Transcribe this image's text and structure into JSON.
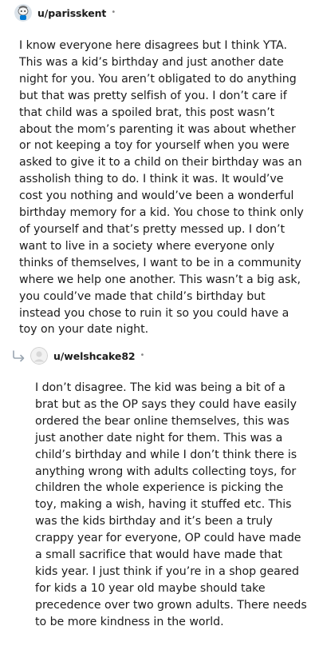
{
  "comments": [
    {
      "username": "u/parisskent",
      "separator": "•",
      "avatar_icon": "snoo-avatar-icon",
      "body": "I know everyone here disagrees but I think YTA. This was a kid’s birthday and just another date night for you. You aren’t obligated to do anything but that was pretty selfish of you. I don’t care if that child was a spoiled brat, this post wasn’t about the mom’s parenting it was about whether or not keeping a toy for yourself when you were asked to give it to a child on their birthday was an assholish thing to do. I think it was. It would’ve cost you nothing and would’ve been a wonderful birthday memory for a kid. You chose to think only of yourself and that’s pretty messed up. I don’t want to live in a society where everyone only thinks of themselves, I want to be in a community where we help one another. This wasn’t a big ask, you could’ve made that child’s birthday but instead you chose to ruin it so you could have a toy on your date night."
    },
    {
      "username": "u/welshcake82",
      "separator": "•",
      "avatar_icon": "default-avatar-icon",
      "reply_icon": "reply-arrow-icon",
      "body": "I don’t disagree. The kid was being a bit of a brat but as the OP says they could have easily ordered the bear online themselves, this was just another date night for them. This was a child’s birthday and while I don’t think there is anything wrong with adults collecting toys, for children the whole experience is picking the toy, making a wish, having it stuffed etc. This was the kids birthday and it’s been a truly crappy year for everyone, OP could have made a small sacrifice that would have made that kids year. I just think if you’re in a shop geared for kids a 10 year old maybe should take precedence over two grown adults. There needs to be more kindness in the world."
    }
  ],
  "colors": {
    "text": "#1c1c1c",
    "muted": "#8a8a8a",
    "avatar_bg": "#dbe3ea",
    "avatar_accent": "#0079d3"
  }
}
